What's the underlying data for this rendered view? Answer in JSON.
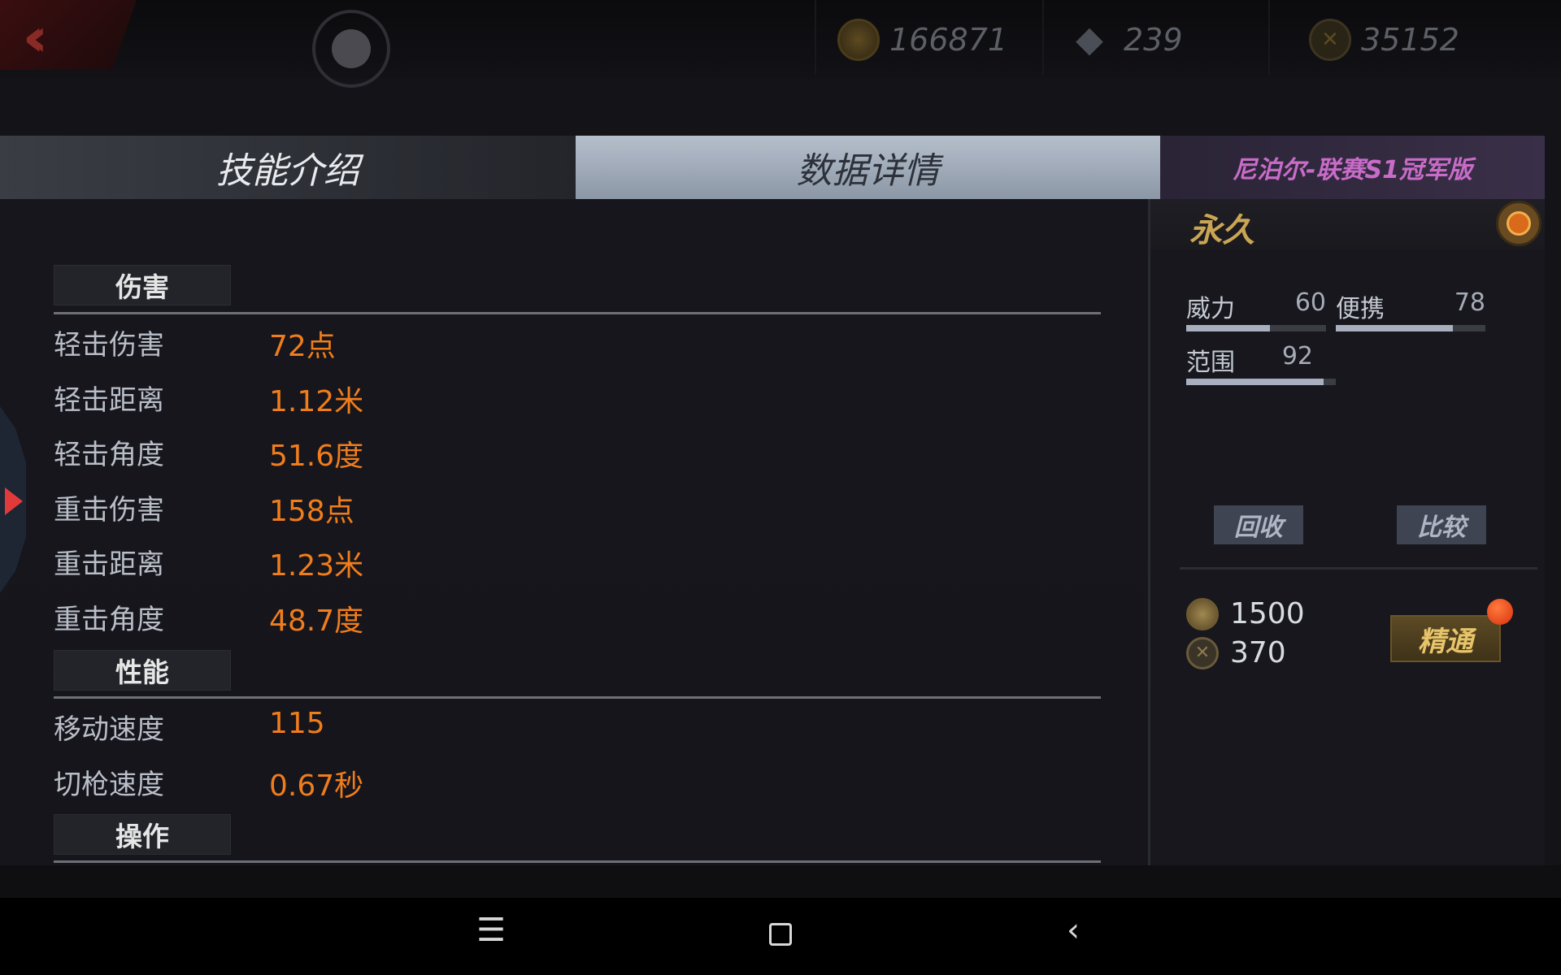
{
  "topbar": {
    "gold": "166871",
    "gems": "239",
    "medals": "35152",
    "medal_icon_text": "",
    "icons": {
      "back": "back-chevron-icon",
      "gold": "gold-coin-icon",
      "gem": "diamond-icon",
      "medal": "medal-icon"
    }
  },
  "tabs": {
    "skills": "技能介绍",
    "data": "数据详情",
    "weapon_name": "尼泊尔-联赛S1冠军版"
  },
  "sections": {
    "damage": {
      "title": "伤害",
      "rows": [
        {
          "label": "轻击伤害",
          "value": "72点"
        },
        {
          "label": "轻击距离",
          "value": "1.12米"
        },
        {
          "label": "轻击角度",
          "value": "51.6度"
        },
        {
          "label": "重击伤害",
          "value": "158点"
        },
        {
          "label": "重击距离",
          "value": "1.23米"
        },
        {
          "label": "重击角度",
          "value": "48.7度"
        }
      ]
    },
    "performance": {
      "title": "性能",
      "rows": [
        {
          "label": "移动速度",
          "value": "115"
        },
        {
          "label": "切枪速度",
          "value": "0.67秒"
        }
      ]
    },
    "operation": {
      "title": "操作"
    }
  },
  "right_panel": {
    "duration": "永久",
    "attributes": [
      {
        "label": "威力",
        "value": "60",
        "level": 0.6
      },
      {
        "label": "便携",
        "value": "78",
        "level": 0.78
      },
      {
        "label": "范围",
        "value": "92",
        "level": 0.92
      }
    ],
    "recycle_button": "回收",
    "compare_button": "比较",
    "cost_gold": "1500",
    "cost_medal": "370",
    "master_button": "精通"
  },
  "colors": {
    "value_orange": "#f07d1c",
    "weapon_purple": "#c86cc8",
    "gold_text": "#e7c469",
    "notification_red": "#e23a1a"
  }
}
